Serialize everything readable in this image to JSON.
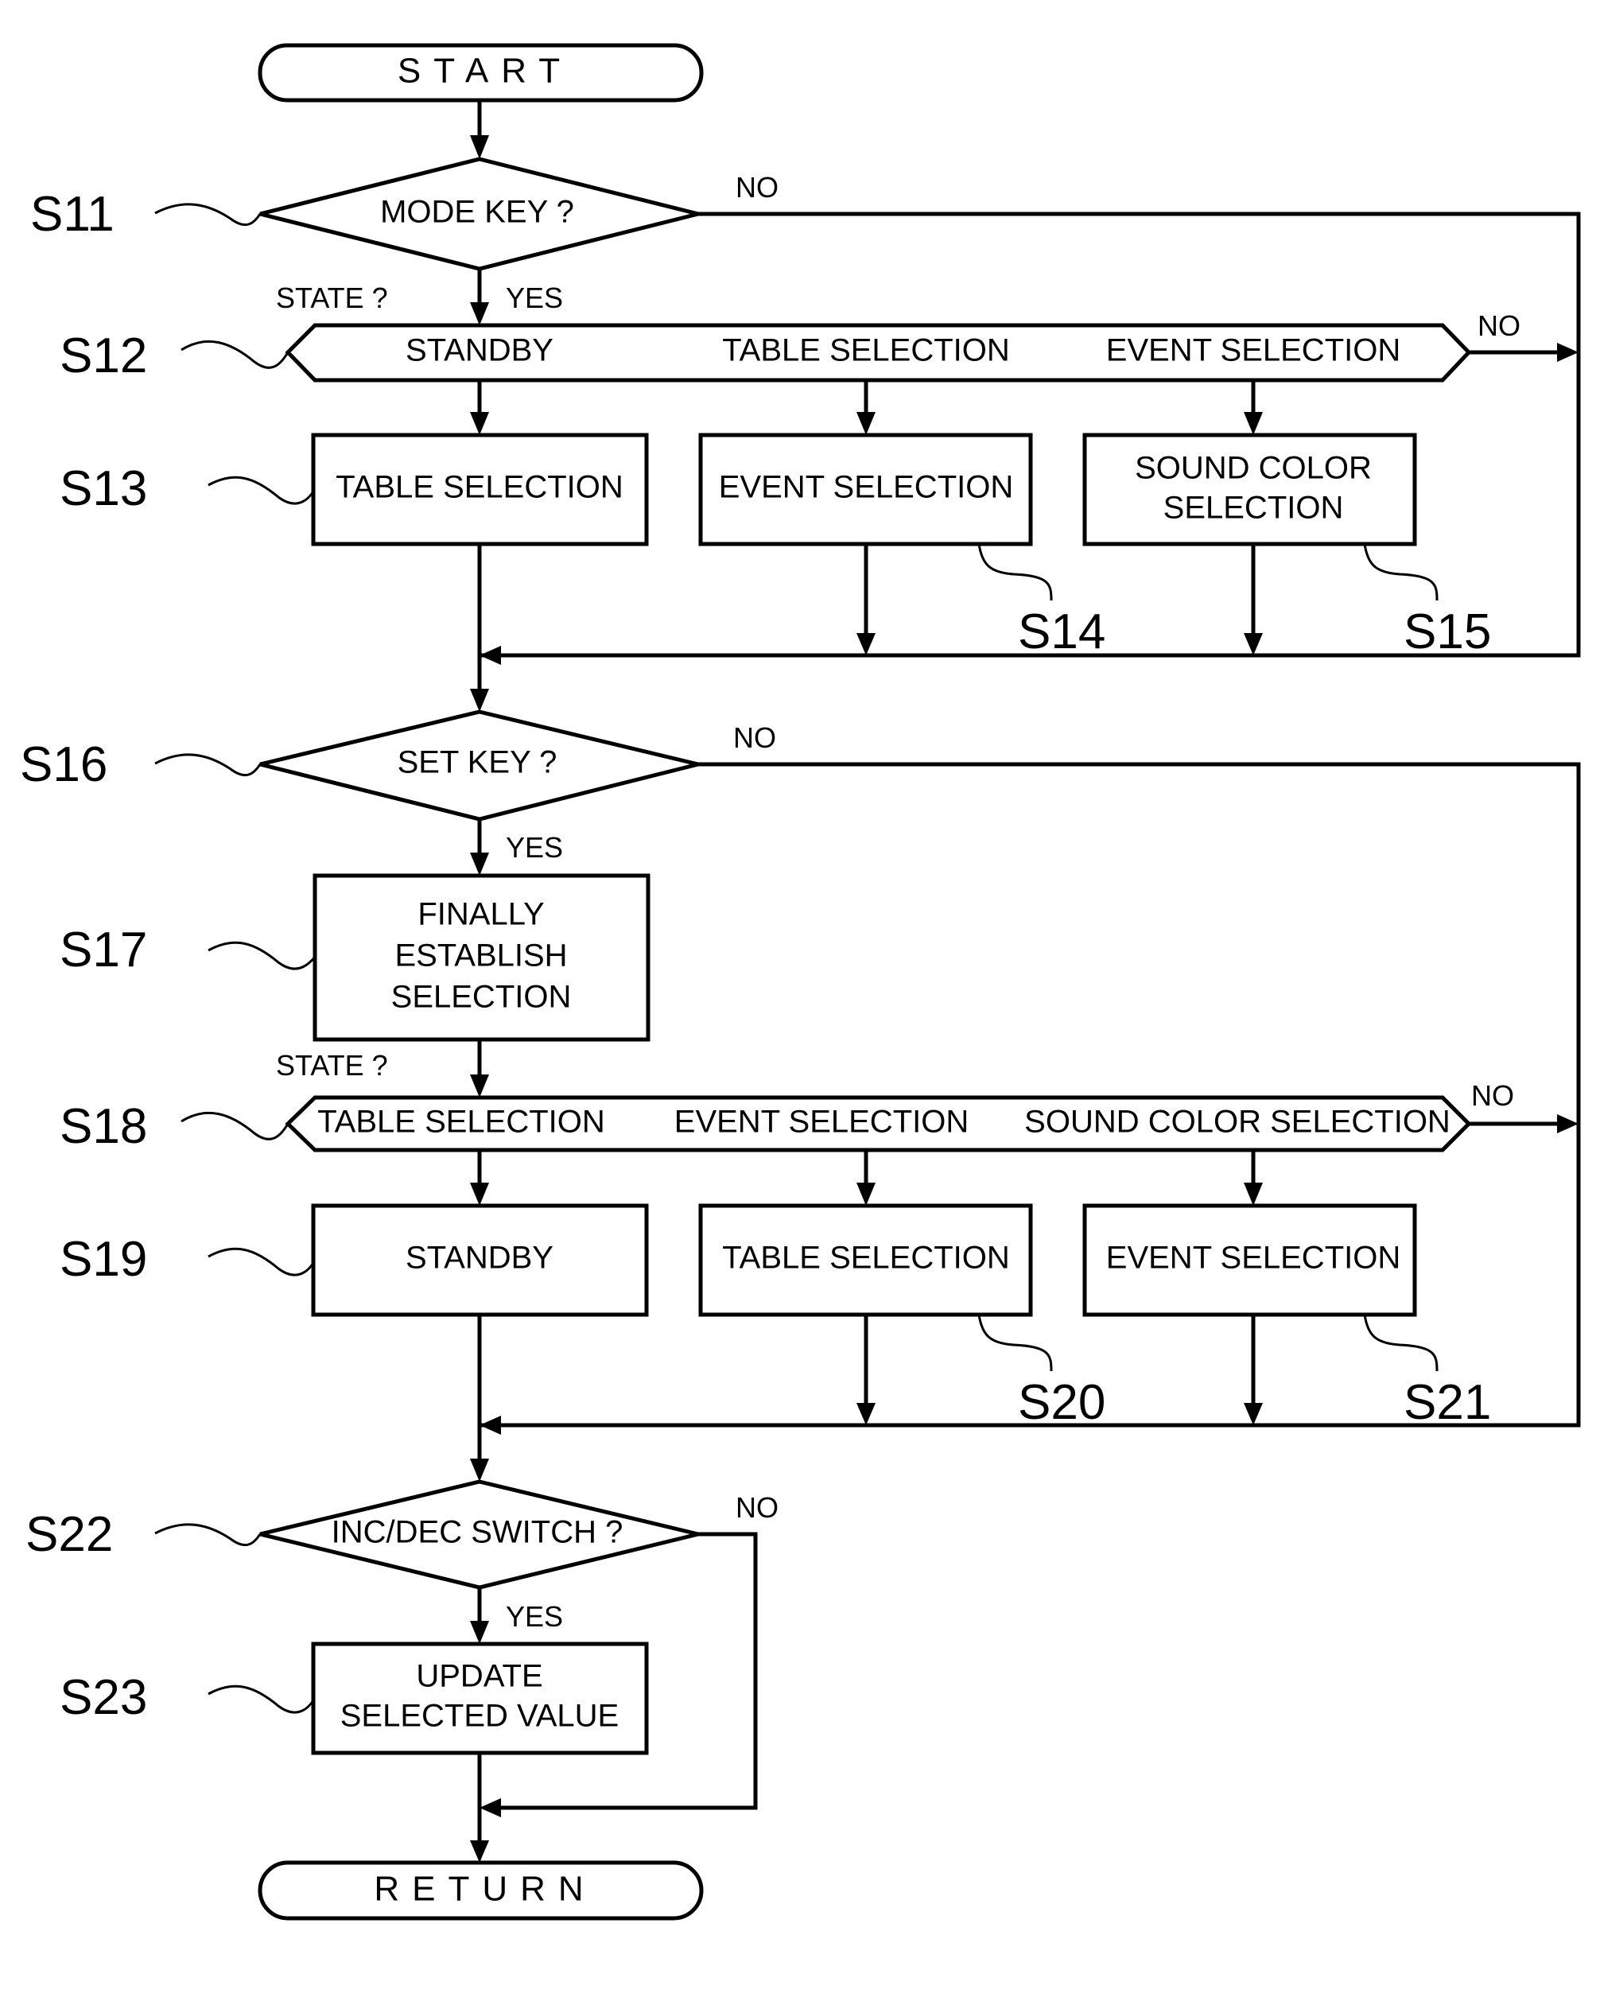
{
  "flowchart": {
    "start": "START",
    "return": "RETURN",
    "s11": {
      "step": "S11",
      "text": "MODE KEY ?",
      "yes": "YES",
      "no": "NO"
    },
    "s12": {
      "step": "S12",
      "question": "STATE ?",
      "branches": [
        "STANDBY",
        "TABLE SELECTION",
        "EVENT SELECTION"
      ],
      "no": "NO"
    },
    "s13": {
      "step": "S13",
      "text": "TABLE SELECTION"
    },
    "s14": {
      "step": "S14",
      "text": "EVENT SELECTION"
    },
    "s15": {
      "step": "S15",
      "lines": [
        "SOUND COLOR",
        "SELECTION"
      ]
    },
    "s16": {
      "step": "S16",
      "text": "SET KEY ?",
      "yes": "YES",
      "no": "NO"
    },
    "s17": {
      "step": "S17",
      "lines": [
        "FINALLY",
        "ESTABLISH",
        "SELECTION"
      ]
    },
    "s18": {
      "step": "S18",
      "question": "STATE ?",
      "branches": [
        "TABLE SELECTION",
        "EVENT SELECTION",
        "SOUND COLOR SELECTION"
      ],
      "no": "NO"
    },
    "s19": {
      "step": "S19",
      "text": "STANDBY"
    },
    "s20": {
      "step": "S20",
      "text": "TABLE SELECTION"
    },
    "s21": {
      "step": "S21",
      "text": "EVENT SELECTION"
    },
    "s22": {
      "step": "S22",
      "text": "INC/DEC SWITCH ?",
      "yes": "YES",
      "no": "NO"
    },
    "s23": {
      "step": "S23",
      "lines": [
        "UPDATE",
        "SELECTED VALUE"
      ]
    }
  }
}
